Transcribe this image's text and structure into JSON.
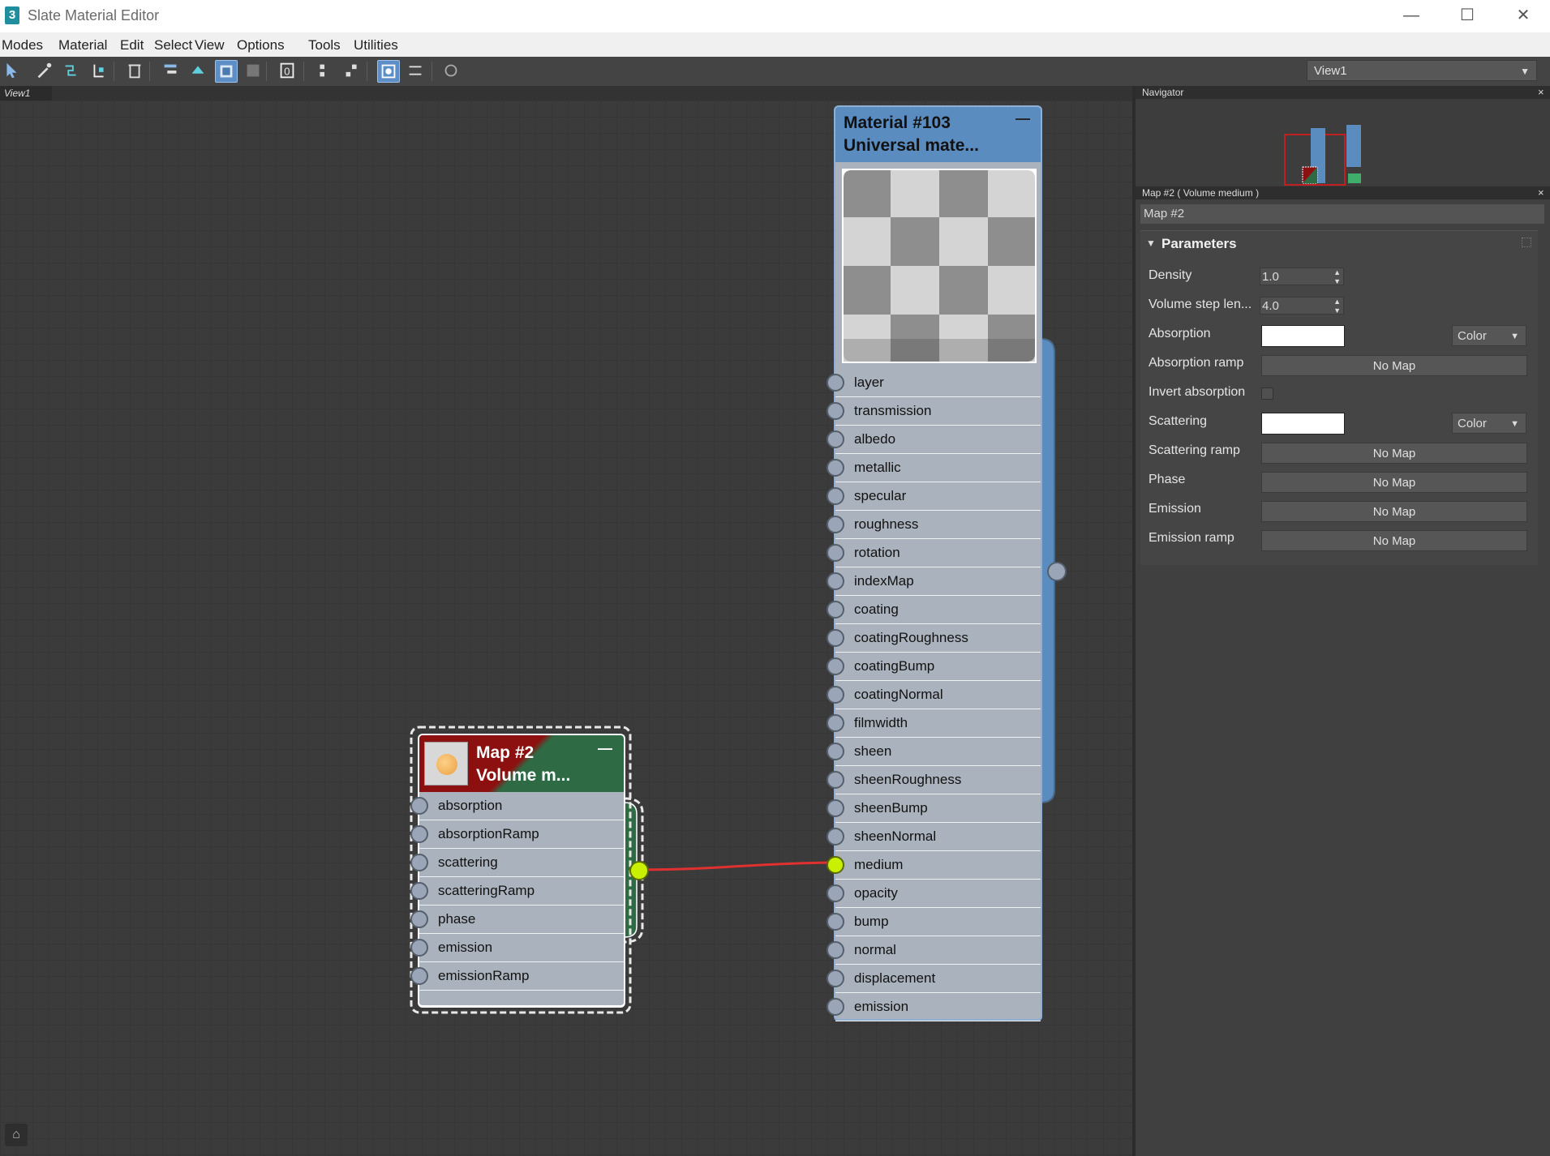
{
  "app": {
    "title": "Slate Material Editor",
    "logo": "3"
  },
  "window_controls": {
    "minimize": "—",
    "maximize": "☐",
    "close": "✕"
  },
  "menu": [
    "Modes",
    "Material",
    "Edit",
    "Select",
    "View",
    "Options",
    "Tools",
    "Utilities"
  ],
  "toolbar": {
    "view_select": "View1",
    "icons": [
      "select-icon",
      "eyedropper-icon",
      "assign-material-icon",
      "put-to-library-icon",
      "delete-icon",
      "move-children-icon",
      "hide-unused-icon",
      "show-map-in-viewport-icon",
      "show-background-icon",
      "material-id-icon",
      "layout-all-icon",
      "layout-children-icon",
      "parameter-editor-icon",
      "select-by-material-icon",
      "options-icon"
    ]
  },
  "view": {
    "tab_label": "View1"
  },
  "material_node": {
    "title_line1": "Material #103",
    "title_line2": "Universal  mate...",
    "collapse": "—",
    "slots": [
      "layer",
      "transmission",
      "albedo",
      "metallic",
      "specular",
      "roughness",
      "rotation",
      "indexMap",
      "coating",
      "coatingRoughness",
      "coatingBump",
      "coatingNormal",
      "filmwidth",
      "sheen",
      "sheenRoughness",
      "sheenBump",
      "sheenNormal",
      "medium",
      "opacity",
      "bump",
      "normal",
      "displacement",
      "emission"
    ],
    "connected_slot": "medium"
  },
  "map_node": {
    "title_line1": "Map #2",
    "title_line2": "Volume  m...",
    "collapse": "—",
    "slots": [
      "absorption",
      "absorptionRamp",
      "scattering",
      "scatteringRamp",
      "phase",
      "emission",
      "emissionRamp"
    ]
  },
  "navigator": {
    "header": "Navigator",
    "close": "×"
  },
  "properties": {
    "header": "Map #2  ( Volume medium )",
    "close": "×",
    "map_name": "Map #2",
    "rollout_title": "Parameters",
    "density": {
      "label": "Density",
      "value": "1.0"
    },
    "volume_step": {
      "label": "Volume step len...",
      "value": "4.0"
    },
    "absorption": {
      "label": "Absorption",
      "mode": "Color"
    },
    "absorption_ramp": {
      "label": "Absorption ramp",
      "button": "No Map"
    },
    "invert_absorption": {
      "label": "Invert absorption"
    },
    "scattering": {
      "label": "Scattering",
      "mode": "Color"
    },
    "scattering_ramp": {
      "label": "Scattering ramp",
      "button": "No Map"
    },
    "phase": {
      "label": "Phase",
      "button": "No Map"
    },
    "emission": {
      "label": "Emission",
      "button": "No Map"
    },
    "emission_ramp": {
      "label": "Emission ramp",
      "button": "No Map"
    }
  },
  "colors": {
    "material_header": "#5b8cc0",
    "map_header_red": "#8c1010",
    "map_header_green": "#2e6b45",
    "wire": "#e03030",
    "socket_active": "#c8f000"
  }
}
